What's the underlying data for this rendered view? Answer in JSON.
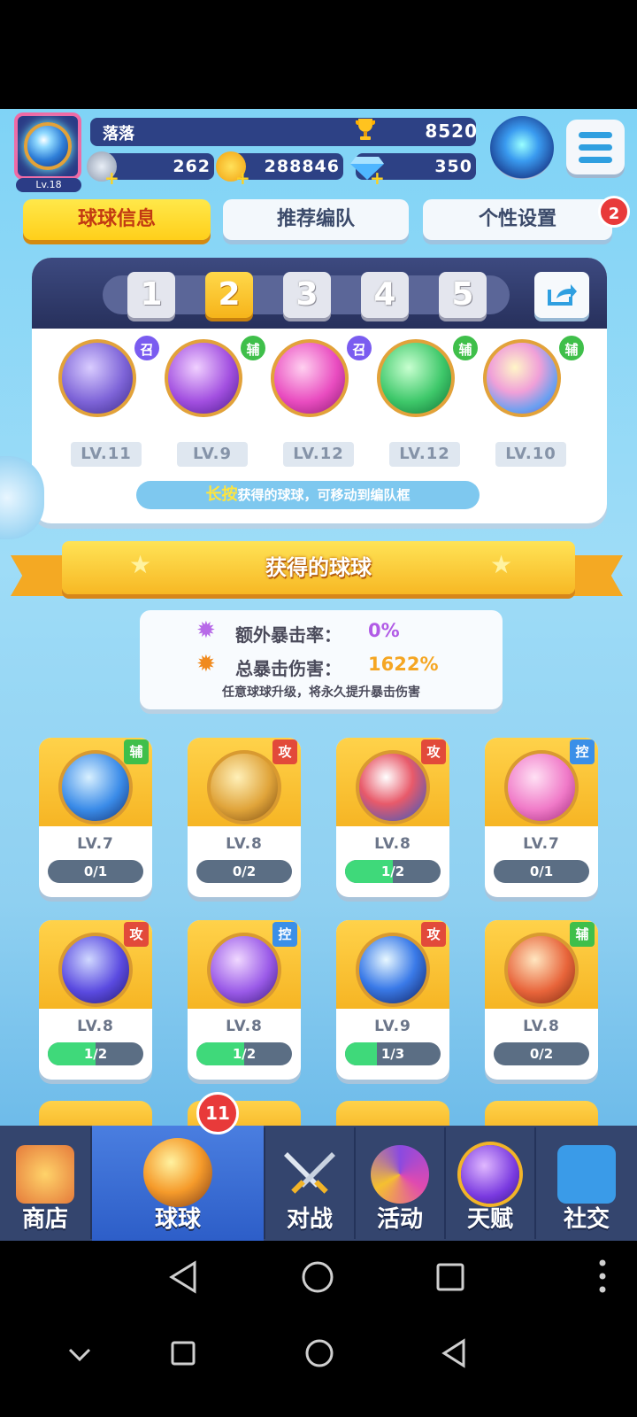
{
  "player": {
    "name": "落落",
    "level": "Lv.18",
    "trophies": "8520",
    "stars": "262",
    "coins": "288846",
    "gems": "350"
  },
  "tabs": [
    {
      "label": "球球信息",
      "active": true
    },
    {
      "label": "推荐编队",
      "active": false
    },
    {
      "label": "个性设置",
      "active": false
    }
  ],
  "tabs_badge": "2",
  "team": {
    "slots": [
      "1",
      "2",
      "3",
      "4",
      "5"
    ],
    "active_slot": "2",
    "balls": [
      {
        "type": "召",
        "level": "LV.11",
        "icon": "ghost-ball-icon"
      },
      {
        "type": "辅",
        "level": "LV.9",
        "icon": "leaf-ball-icon"
      },
      {
        "type": "召",
        "level": "LV.12",
        "icon": "dagger-ball-icon"
      },
      {
        "type": "辅",
        "level": "LV.12",
        "icon": "arrow-star-ball-icon"
      },
      {
        "type": "辅",
        "level": "LV.10",
        "icon": "crowd-ball-icon"
      }
    ],
    "hint_highlight": "长按",
    "hint_text": "获得的球球，可移动到编队框"
  },
  "section_title": "获得的球球",
  "stats": {
    "extra_crit_label": "额外暴击率：",
    "extra_crit_value": "0%",
    "total_crit_label": "总暴击伤害：",
    "total_crit_value": "1622%",
    "note": "任意球球升级，将永久提升暴击伤害"
  },
  "cards": [
    {
      "type": "辅",
      "level": "LV.7",
      "progress": "0/1",
      "fill": 0
    },
    {
      "type": "攻",
      "level": "LV.8",
      "progress": "0/2",
      "fill": 0
    },
    {
      "type": "攻",
      "level": "LV.8",
      "progress": "1/2",
      "fill": 0.5
    },
    {
      "type": "控",
      "level": "LV.7",
      "progress": "0/1",
      "fill": 0
    },
    {
      "type": "攻",
      "level": "LV.8",
      "progress": "1/2",
      "fill": 0.5
    },
    {
      "type": "控",
      "level": "LV.8",
      "progress": "1/2",
      "fill": 0.5
    },
    {
      "type": "攻",
      "level": "LV.9",
      "progress": "1/3",
      "fill": 0.333
    },
    {
      "type": "辅",
      "level": "LV.8",
      "progress": "0/2",
      "fill": 0
    }
  ],
  "nav": [
    {
      "label": "商店",
      "icon": "shop-icon"
    },
    {
      "label": "球球",
      "icon": "balls-icon",
      "active": true,
      "badge": "11"
    },
    {
      "label": "对战",
      "icon": "crossed-swords-icon"
    },
    {
      "label": "活动",
      "icon": "party-popper-icon"
    },
    {
      "label": "天赋",
      "icon": "planet-icon"
    },
    {
      "label": "社交",
      "icon": "chat-heart-icon"
    }
  ],
  "colors": {
    "type_召": "#7a5cf0",
    "type_辅": "#3fbf4a",
    "type_攻": "#e24a3a",
    "type_控": "#3a8fe8",
    "progress_fill": "#3fd97a",
    "accent_yellow": "#ffcf1a"
  }
}
